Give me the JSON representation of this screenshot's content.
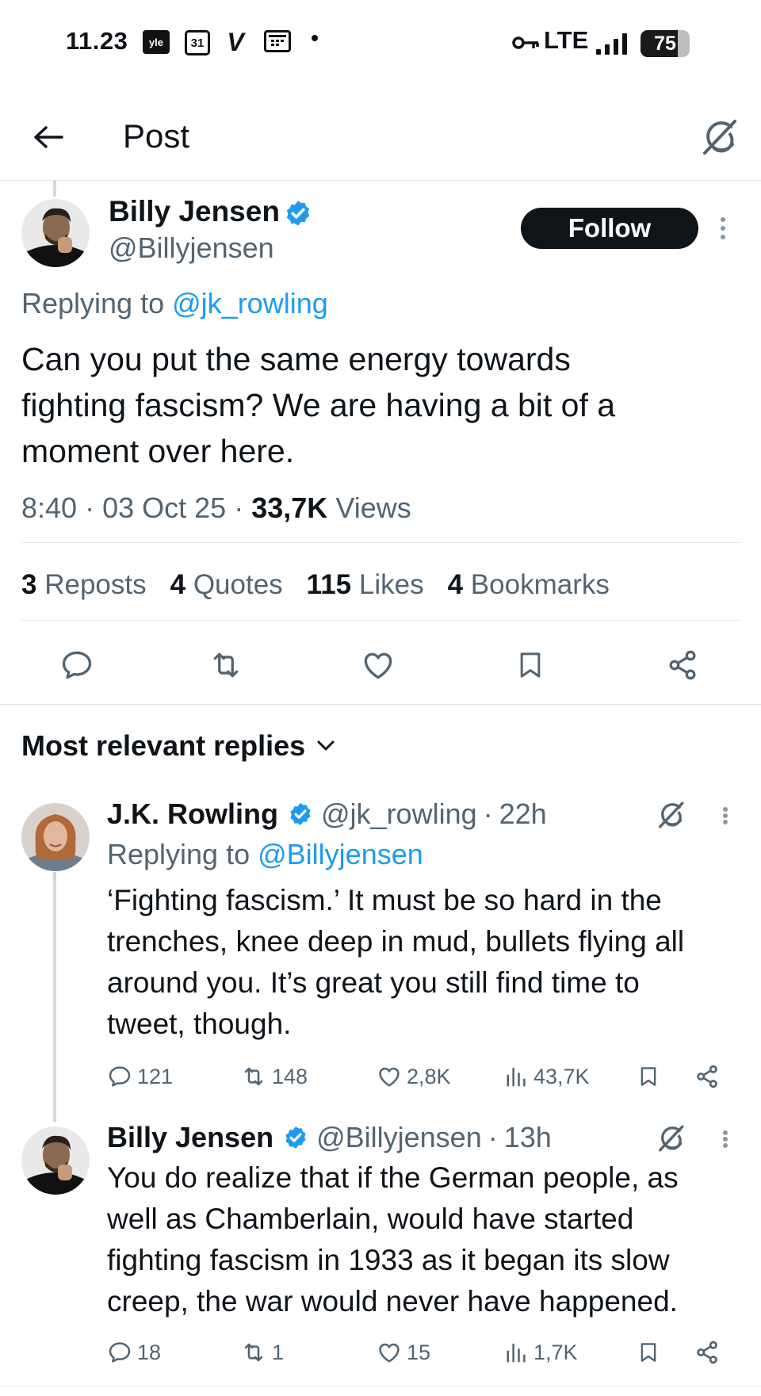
{
  "status_bar": {
    "time": "11.23",
    "yle_label": "yle",
    "calendar_day": "31",
    "v_label": "V",
    "network": "LTE",
    "battery": "75",
    "battery_level_percent": 75
  },
  "header": {
    "title": "Post"
  },
  "main_post": {
    "author_name": "Billy Jensen",
    "handle": "@Billyjensen",
    "follow_label": "Follow",
    "replying_prefix": "Replying to",
    "replying_to": "@jk_rowling",
    "text": "Can you put the same energy towards\nfighting fascism? We are having a bit of a\nmoment over here.",
    "time": "8:40",
    "date": "03 Oct 25",
    "views_count": "33,7K",
    "views_label": "Views",
    "separator": "·"
  },
  "stats": {
    "reposts_count": "3",
    "reposts_label": "Reposts",
    "quotes_count": "4",
    "quotes_label": "Quotes",
    "likes_count": "115",
    "likes_label": "Likes",
    "bookmarks_count": "4",
    "bookmarks_label": "Bookmarks"
  },
  "replies_section": {
    "title": "Most relevant replies"
  },
  "replies": [
    {
      "author_name": "J.K. Rowling",
      "handle": "@jk_rowling",
      "age": "22h",
      "replying_prefix": "Replying to",
      "replying_to": "@Billyjensen",
      "text": "‘Fighting fascism.’ It must be so hard in the\ntrenches, knee deep in mud, bullets flying all\naround you. It’s great you still find time to\ntweet, though.",
      "replies": "121",
      "reposts": "148",
      "likes": "2,8K",
      "views": "43,7K"
    },
    {
      "author_name": "Billy Jensen",
      "handle": "@Billyjensen",
      "age": "13h",
      "text": "You do realize that if the German people, as\nwell as Chamberlain, would have started\nfighting fascism in 1933 as it began its slow\ncreep, the war would never have happened.",
      "replies": "18",
      "reposts": "1",
      "likes": "15",
      "views": "1,7K"
    }
  ],
  "colors": {
    "text": "#0f1419",
    "secondary": "#536471",
    "accent": "#1d9bf0",
    "verified": "#1d9bf0",
    "divider": "#e3e6e9"
  }
}
